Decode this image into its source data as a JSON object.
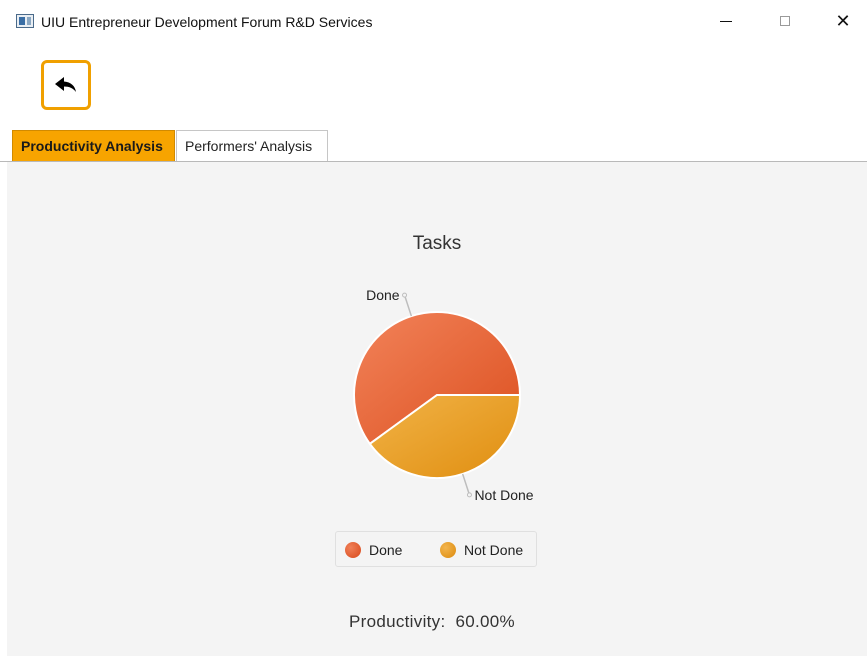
{
  "window": {
    "title": "UIU Entrepreneur Development Forum R&D Services",
    "icon": "app-window-icon",
    "controls": {
      "minimize": "minimize-icon",
      "maximize": "maximize-icon",
      "close_glyph": "✕"
    }
  },
  "toolbar": {
    "back_icon": "back-arrow-icon",
    "accent_color": "#f0a000"
  },
  "tabs": [
    {
      "label": "Productivity Analysis",
      "active": true
    },
    {
      "label": "Performers' Analysis",
      "active": false
    }
  ],
  "chart_data": {
    "type": "pie",
    "title": "Tasks",
    "slices": [
      {
        "name": "Done",
        "value": 60,
        "color": "#e5622f"
      },
      {
        "name": "Not Done",
        "value": 40,
        "color": "#eba12a"
      }
    ],
    "legend": [
      "Done",
      "Not Done"
    ],
    "legend_placement": "bottom"
  },
  "summary": {
    "label": "Productivity:",
    "value": "60.00%"
  }
}
